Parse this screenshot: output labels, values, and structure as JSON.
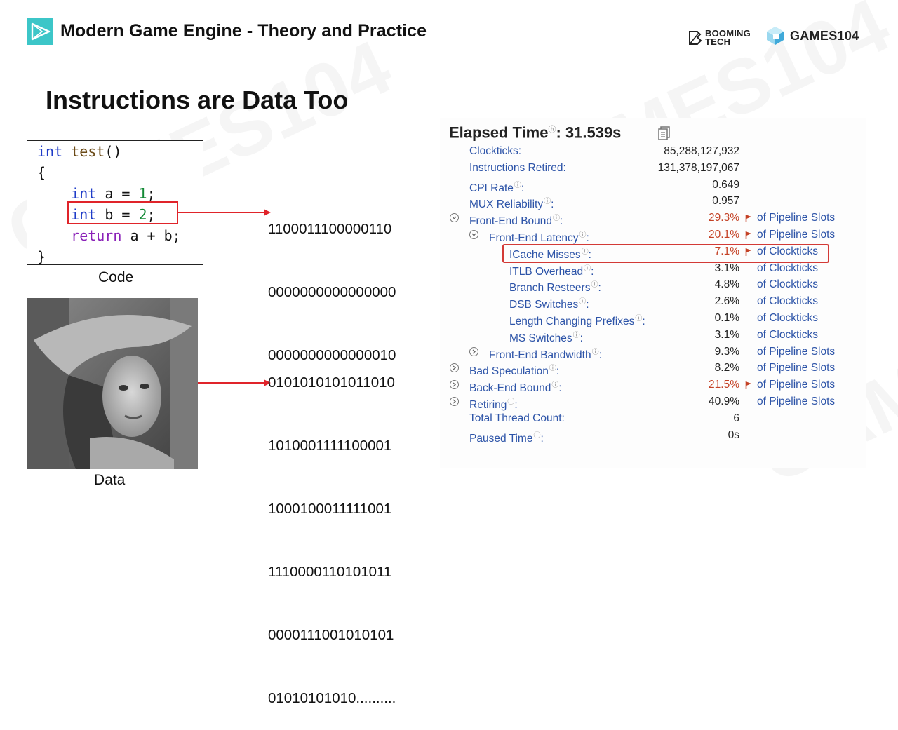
{
  "header": {
    "course_title": "Modern Game Engine - Theory and Practice",
    "booming_line1": "BOOMING",
    "booming_line2": "TECH",
    "games_text": "GAMES104",
    "accent_color": "#3cc6c8"
  },
  "slide": {
    "title": "Instructions are Data Too",
    "code": {
      "line1_kw": "int",
      "line1_fn": "test",
      "line1_rest": "()",
      "line2": "{",
      "line3_kw": "int",
      "line3_mid": " a = ",
      "line3_num": "1",
      "line3_end": ";",
      "line4_kw": "int",
      "line4_mid": " b = ",
      "line4_num": "2",
      "line4_end": ";",
      "line5_kw": "return",
      "line5_rest": " a + b;",
      "line6": "}"
    },
    "code_caption": "Code",
    "data_caption": "Data",
    "instruction_bits": [
      "1100011100000110",
      "0000000000000000",
      "0000000000000010"
    ],
    "data_bits": [
      "0101010101011010",
      "1010001111100001",
      "1000100011111001",
      "1110000110101011",
      "0000111001010101",
      "01010101010.........."
    ]
  },
  "profiler": {
    "elapsed_label": "Elapsed Time",
    "elapsed_value": ": 31.539s",
    "rows": [
      {
        "name": "Clockticks:",
        "value": "85,288,127,932",
        "unit": ""
      },
      {
        "name": "Instructions Retired:",
        "value": "131,378,197,067",
        "unit": ""
      },
      {
        "name": "CPI Rate",
        "value": "0.649",
        "unit": ""
      },
      {
        "name": "MUX Reliability",
        "value": "0.957",
        "unit": ""
      },
      {
        "name": "Front-End Bound",
        "value": "29.3%",
        "unit": "of Pipeline Slots"
      },
      {
        "name": "Front-End Latency",
        "value": "20.1%",
        "unit": "of Pipeline Slots"
      },
      {
        "name": "ICache Misses",
        "value": "7.1%",
        "unit": "of Clockticks"
      },
      {
        "name": "ITLB Overhead",
        "value": "3.1%",
        "unit": "of Clockticks"
      },
      {
        "name": "Branch Resteers",
        "value": "4.8%",
        "unit": "of Clockticks"
      },
      {
        "name": "DSB Switches",
        "value": "2.6%",
        "unit": "of Clockticks"
      },
      {
        "name": "Length Changing Prefixes",
        "value": "0.1%",
        "unit": "of Clockticks"
      },
      {
        "name": "MS Switches",
        "value": "3.1%",
        "unit": "of Clockticks"
      },
      {
        "name": "Front-End Bandwidth",
        "value": "9.3%",
        "unit": "of Pipeline Slots"
      },
      {
        "name": "Bad Speculation",
        "value": "8.2%",
        "unit": "of Pipeline Slots"
      },
      {
        "name": "Back-End Bound",
        "value": "21.5%",
        "unit": "of Pipeline Slots"
      },
      {
        "name": "Retiring",
        "value": "40.9%",
        "unit": "of Pipeline Slots"
      },
      {
        "name": "Total Thread Count:",
        "value": "6",
        "unit": ""
      },
      {
        "name": "Paused Time",
        "value": "0s",
        "unit": ""
      }
    ],
    "warn_color": "#c44125",
    "link_color": "#2d54a8"
  }
}
